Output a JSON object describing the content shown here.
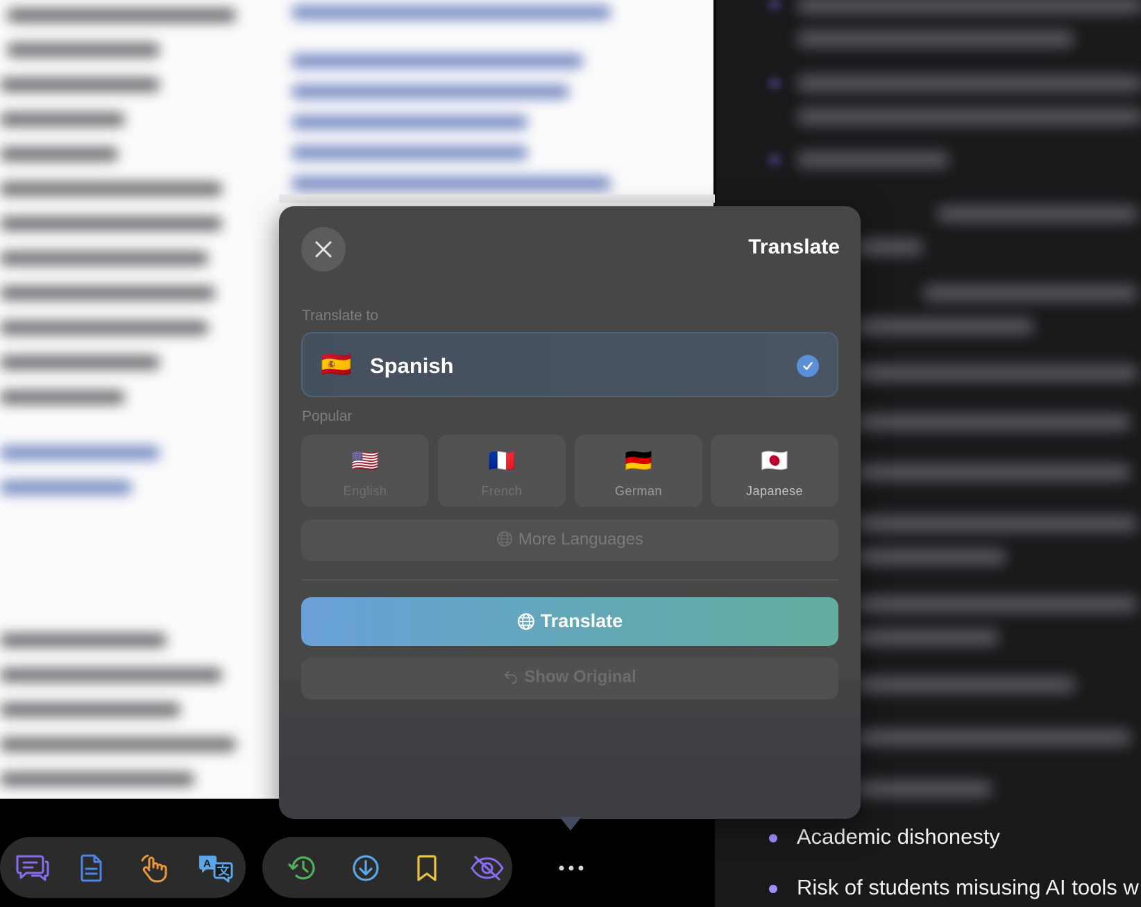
{
  "panel": {
    "title": "Translate",
    "translate_to_label": "Translate to",
    "selected_language": {
      "name": "Spanish",
      "flag": "🇪🇸"
    },
    "popular_label": "Popular",
    "popular": [
      {
        "name": "English",
        "flag": "🇺🇸"
      },
      {
        "name": "French",
        "flag": "🇫🇷"
      },
      {
        "name": "German",
        "flag": "🇩🇪"
      },
      {
        "name": "Japanese",
        "flag": "🇯🇵"
      }
    ],
    "more_languages_label": "More Languages",
    "translate_button_label": "Translate",
    "show_original_label": "Show Original"
  },
  "background_list": {
    "items": [
      "Academic dishonesty",
      "Risk of students misusing AI tools w"
    ]
  },
  "dock": {
    "group1": [
      "chat-icon",
      "document-icon",
      "tap-gesture-icon",
      "translate-icon"
    ],
    "group2": [
      "history-icon",
      "download-icon",
      "bookmark-icon",
      "hide-icon"
    ],
    "more": "more-icon"
  },
  "colors": {
    "accent_gradient_start": "#6aa1d9",
    "accent_gradient_end": "#63ae9f",
    "check_blue": "#5a90d8",
    "dock_purple": "#8b6cf0",
    "dock_blue": "#4e86e8",
    "dock_orange": "#e89a3a",
    "dock_green": "#4fb25b",
    "dock_sky": "#5aa6e8",
    "dock_yellow": "#e8c23a"
  }
}
